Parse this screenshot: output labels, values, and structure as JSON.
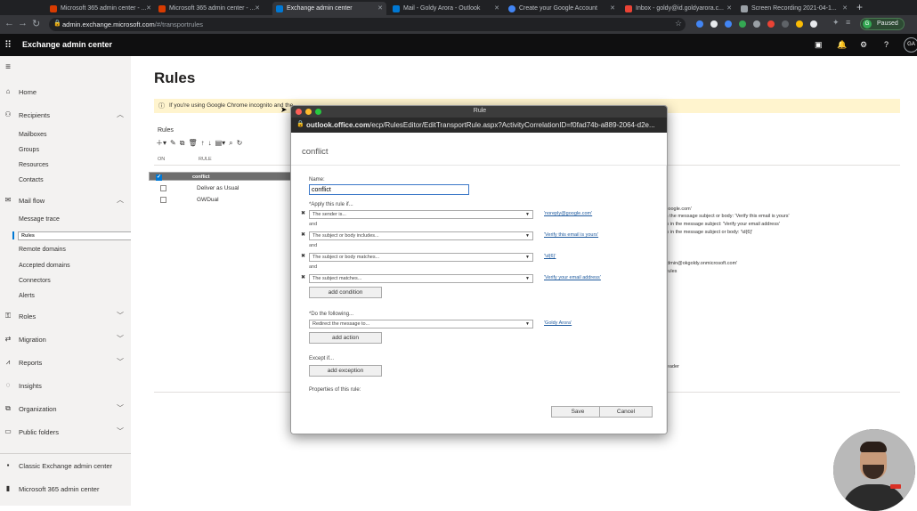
{
  "browser": {
    "tabs": [
      {
        "title": "Microsoft 365 admin center - ...",
        "color": "#d83b01"
      },
      {
        "title": "Microsoft 365 admin center - ...",
        "color": "#d83b01"
      },
      {
        "title": "Exchange admin center",
        "color": "#0078d4"
      },
      {
        "title": "Mail - Goldy Arora - Outlook",
        "color": "#0078d4"
      },
      {
        "title": "Create your Google Account",
        "color": "#4285f4"
      },
      {
        "title": "Inbox - goldy@id.goldyarora.c...",
        "color": "#ea4335"
      },
      {
        "title": "Screen Recording 2021-04-1...",
        "color": "#9aa0a6"
      }
    ],
    "new_tab": "+",
    "url_host": "admin.exchange.microsoft.com",
    "url_path": "/#/transportrules",
    "profile_initial": "G",
    "profile_status": "Paused"
  },
  "app": {
    "title": "Exchange admin center",
    "user_initials": "GA"
  },
  "nav": {
    "home": "Home",
    "recipients": "Recipients",
    "recipients_items": [
      "Mailboxes",
      "Groups",
      "Resources",
      "Contacts"
    ],
    "mail_flow": "Mail flow",
    "mail_flow_items": [
      "Message trace",
      "Rules",
      "Remote domains",
      "Accepted domains",
      "Connectors",
      "Alerts"
    ],
    "roles": "Roles",
    "migration": "Migration",
    "reports": "Reports",
    "insights": "Insights",
    "organization": "Organization",
    "public_folders": "Public folders",
    "classic": "Classic Exchange admin center",
    "m365": "Microsoft 365 admin center"
  },
  "page": {
    "title": "Rules",
    "banner": "If you're using Google Chrome incognito and the",
    "rules_label": "Rules",
    "col_on": "ON",
    "col_rule": "RULE",
    "rules": [
      {
        "name": "conflict",
        "checked": true,
        "selected": true
      },
      {
        "name": "Deliver as Usual",
        "checked": false,
        "selected": false
      },
      {
        "name": "GWDual",
        "checked": false,
        "selected": false
      }
    ],
    "detail_lines": [
      "y@google.com'",
      "ds in the message subject or body: 'Verify this email is yours'",
      "terns in the message subject: 'Verify your email address'",
      "terns in the message subject or body: '\\d{6}'",
      "to 'admin@okgoldy.onmicrosoft.com'",
      "ore rules",
      "s, Header"
    ]
  },
  "modal": {
    "window_title": "Rule",
    "url_host": "outlook.office.com",
    "url_path": "/ecp/RulesEditor/EditTransportRule.aspx?ActivityCorrelationID=f0fad74b-a889-2064-d2e...",
    "heading": "conflict",
    "name_label": "Name:",
    "name_value": "conflict",
    "apply_label": "*Apply this rule if...",
    "conditions": [
      {
        "select": "The sender is...",
        "value": "'noreply@google.com'"
      },
      {
        "select": "The subject or body includes...",
        "value": "'Verify this email is yours'"
      },
      {
        "select": "The subject or body matches...",
        "value": "'\\d{6}'"
      },
      {
        "select": "The subject matches...",
        "value": "'Verify your email address'"
      }
    ],
    "and_label": "and",
    "add_condition": "add condition",
    "do_label": "*Do the following...",
    "action_select": "Redirect the message to...",
    "action_value": "'Goldy Arora'",
    "add_action": "add action",
    "except_label": "Except if...",
    "add_exception": "add exception",
    "properties_label": "Properties of this rule:",
    "save": "Save",
    "cancel": "Cancel"
  }
}
